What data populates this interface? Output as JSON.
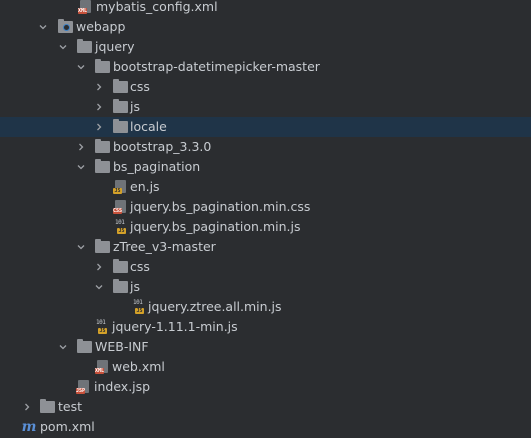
{
  "tree": [
    {
      "label": "mybatis_config.xml",
      "icon": "xml-file-icon",
      "expanded": null
    },
    {
      "label": "webapp",
      "icon": "web-folder-icon",
      "expanded": true
    },
    {
      "label": "jquery",
      "icon": "folder-icon",
      "expanded": true
    },
    {
      "label": "bootstrap-datetimepicker-master",
      "icon": "folder-icon",
      "expanded": true
    },
    {
      "label": "css",
      "icon": "folder-icon",
      "expanded": false
    },
    {
      "label": "js",
      "icon": "folder-icon",
      "expanded": false
    },
    {
      "label": "locale",
      "icon": "folder-icon",
      "expanded": false,
      "selected": true
    },
    {
      "label": "bootstrap_3.3.0",
      "icon": "folder-icon",
      "expanded": false
    },
    {
      "label": "bs_pagination",
      "icon": "folder-icon",
      "expanded": true
    },
    {
      "label": "en.js",
      "icon": "js-file-icon",
      "expanded": null
    },
    {
      "label": "jquery.bs_pagination.min.css",
      "icon": "css-file-icon",
      "expanded": null
    },
    {
      "label": "jquery.bs_pagination.min.js",
      "icon": "minified-js-file-icon",
      "expanded": null
    },
    {
      "label": "zTree_v3-master",
      "icon": "folder-icon",
      "expanded": true
    },
    {
      "label": "css",
      "icon": "folder-icon",
      "expanded": false
    },
    {
      "label": "js",
      "icon": "folder-icon",
      "expanded": true
    },
    {
      "label": "jquery.ztree.all.min.js",
      "icon": "minified-js-file-icon",
      "expanded": null
    },
    {
      "label": "jquery-1.11.1-min.js",
      "icon": "minified-js-file-icon",
      "expanded": null
    },
    {
      "label": "WEB-INF",
      "icon": "folder-icon",
      "expanded": true
    },
    {
      "label": "web.xml",
      "icon": "web-xml-file-icon",
      "expanded": null
    },
    {
      "label": "index.jsp",
      "icon": "jsp-file-icon",
      "expanded": null
    },
    {
      "label": "test",
      "icon": "folder-icon",
      "expanded": false
    },
    {
      "label": "pom.xml",
      "icon": "maven-pom-icon",
      "expanded": null
    }
  ],
  "icon_text": {
    "js": "JS",
    "css": "CSS",
    "xml": "XML",
    "jsp": "JSP",
    "bits": "101",
    "maven": "m"
  },
  "colors": {
    "background": "#2b2d30",
    "selected_row": "#1f3448",
    "text": "#c8ccd1",
    "folder": "#8e9196",
    "js_badge": "#d4a129",
    "css_badge": "#c7513b",
    "maven": "#5a8fd6"
  }
}
